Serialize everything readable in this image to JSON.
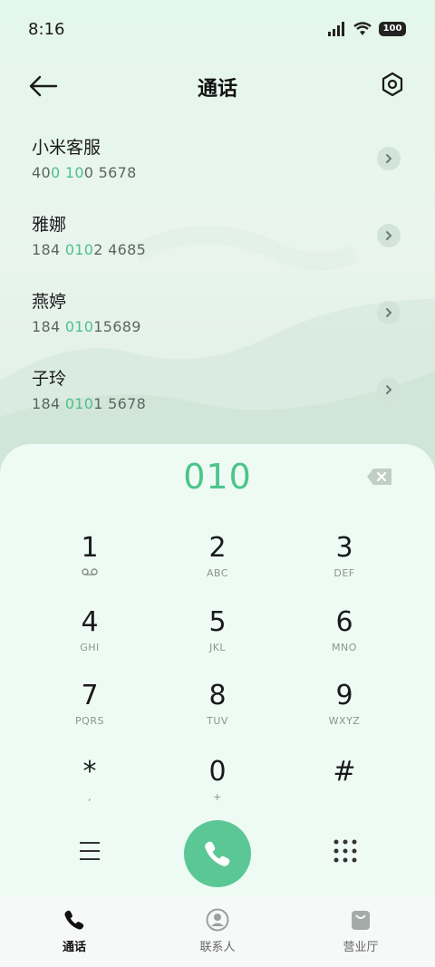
{
  "status": {
    "time": "8:16",
    "battery": "100"
  },
  "header": {
    "title": "通话"
  },
  "contacts": [
    {
      "name": "小米客服",
      "num_parts": [
        "40",
        "0 10",
        "0 5678"
      ]
    },
    {
      "name": "雅娜",
      "num_parts": [
        "184 ",
        "010",
        "2 4685"
      ]
    },
    {
      "name": "燕婷",
      "num_parts": [
        "184 ",
        "010",
        "15689"
      ]
    },
    {
      "name": "子玲",
      "num_parts": [
        "184 ",
        "010",
        "1 5678"
      ]
    }
  ],
  "dialer": {
    "input": "010",
    "keys": [
      {
        "digit": "1",
        "sub": ""
      },
      {
        "digit": "2",
        "sub": "ABC"
      },
      {
        "digit": "3",
        "sub": "DEF"
      },
      {
        "digit": "4",
        "sub": "GHI"
      },
      {
        "digit": "5",
        "sub": "JKL"
      },
      {
        "digit": "6",
        "sub": "MNO"
      },
      {
        "digit": "7",
        "sub": "PQRS"
      },
      {
        "digit": "8",
        "sub": "TUV"
      },
      {
        "digit": "9",
        "sub": "WXYZ"
      },
      {
        "digit": "*",
        "sub": ","
      },
      {
        "digit": "0",
        "sub": "+"
      },
      {
        "digit": "#",
        "sub": ""
      }
    ]
  },
  "tabs": [
    {
      "label": "通话",
      "icon": "phone-icon"
    },
    {
      "label": "联系人",
      "icon": "person-icon"
    },
    {
      "label": "营业厅",
      "icon": "bag-icon"
    }
  ],
  "colors": {
    "accent": "#4fc08b",
    "call_button": "#5bc795"
  }
}
